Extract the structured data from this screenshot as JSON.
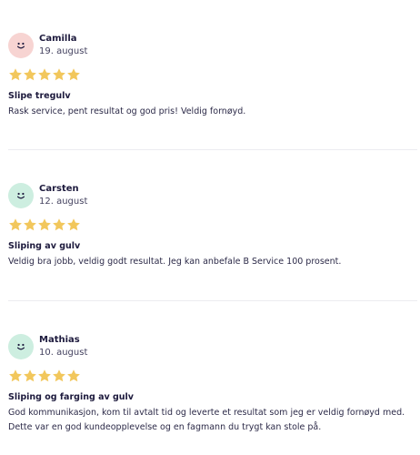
{
  "reviews": [
    {
      "name": "Camilla",
      "date": "19. august",
      "rating": 5,
      "avatar_color": "#f7d4d2",
      "avatar_icon": "smiley-face-icon",
      "title": "Slipe tregulv",
      "text": "Rask service, pent resultat og god pris! Veldig fornøyd."
    },
    {
      "name": "Carsten",
      "date": "12. august",
      "rating": 5,
      "avatar_color": "#cdeee0",
      "avatar_icon": "smiley-face-icon",
      "title": "Sliping av gulv",
      "text": "Veldig bra jobb, veldig godt resultat. Jeg kan anbefale B Service 100 prosent."
    },
    {
      "name": "Mathias",
      "date": "10. august",
      "rating": 5,
      "avatar_color": "#cdeee0",
      "avatar_icon": "smiley-face-icon",
      "title": "Sliping og farging av gulv",
      "text": "God kommunikasjon, kom til avtalt tid og leverte et resultat som jeg er veldig fornøyd med. Dette var en god kundeopplevelse og en fagmann du trygt kan stole på."
    }
  ],
  "colors": {
    "star": "#f2c75c",
    "text_dark": "#1d1a3d",
    "divider": "#ececf0"
  }
}
